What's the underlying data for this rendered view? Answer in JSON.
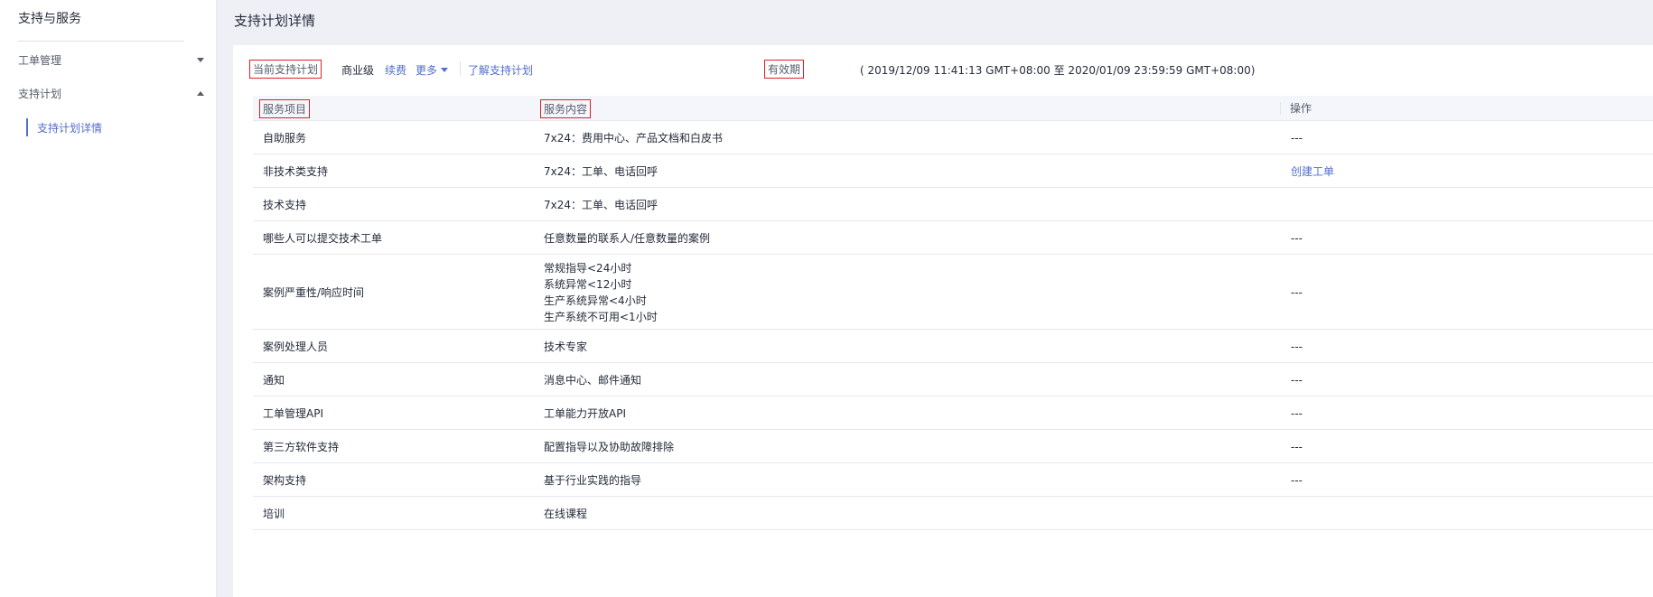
{
  "sidebar": {
    "title": "支持与服务",
    "menu": [
      {
        "label": "工单管理",
        "expanded": false
      },
      {
        "label": "支持计划",
        "expanded": true,
        "children": [
          {
            "label": "支持计划详情",
            "active": true
          }
        ]
      }
    ]
  },
  "page": {
    "title": "支持计划详情"
  },
  "plan": {
    "current_label": "当前支持计划",
    "level": "商业级",
    "renew": "续费",
    "more": "更多",
    "learn": "了解支持计划",
    "validity_label": "有效期",
    "validity_range": "( 2019/12/09 11:41:13 GMT+08:00 至 2020/01/09 23:59:59 GMT+08:00)"
  },
  "table": {
    "headers": [
      "服务项目",
      "服务内容",
      "操作"
    ],
    "rows": [
      {
        "item": "自助服务",
        "content": [
          "7x24：费用中心、产品文档和白皮书"
        ],
        "action": "---"
      },
      {
        "item": "非技术类支持",
        "content": [
          "7x24：工单、电话回呼"
        ],
        "action": "创建工单",
        "action_link": true
      },
      {
        "item": "技术支持",
        "content": [
          "7x24：工单、电话回呼"
        ],
        "action": ""
      },
      {
        "item": "哪些人可以提交技术工单",
        "content": [
          "任意数量的联系人/任意数量的案例"
        ],
        "action": "---"
      },
      {
        "item": "案例严重性/响应时间",
        "content": [
          "常规指导<24小时",
          "系统异常<12小时",
          "生产系统异常<4小时",
          "生产系统不可用<1小时"
        ],
        "action": "---"
      },
      {
        "item": "案例处理人员",
        "content": [
          "技术专家"
        ],
        "action": "---"
      },
      {
        "item": "通知",
        "content": [
          "消息中心、邮件通知"
        ],
        "action": "---"
      },
      {
        "item": "工单管理API",
        "content": [
          "工单能力开放API"
        ],
        "action": "---"
      },
      {
        "item": "第三方软件支持",
        "content": [
          "配置指导以及协助故障排除"
        ],
        "action": "---"
      },
      {
        "item": "架构支持",
        "content": [
          "基于行业实践的指导"
        ],
        "action": "---"
      },
      {
        "item": "培训",
        "content": [
          "在线课程"
        ],
        "action": ""
      }
    ]
  },
  "colors": {
    "accent": "#526ecc",
    "highlight_box": "#e02020",
    "background": "#eef0f5"
  }
}
